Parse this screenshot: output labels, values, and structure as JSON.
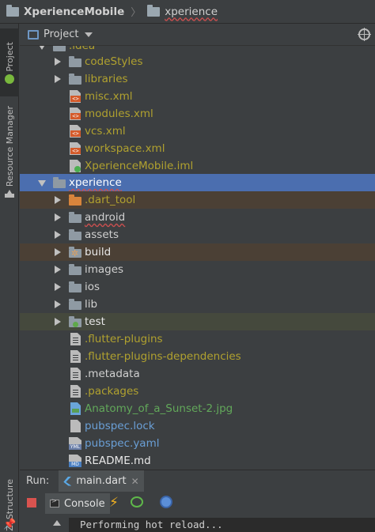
{
  "breadcrumb": {
    "root": "XperienceMobile",
    "child": "xperience"
  },
  "left_strip": {
    "project_tab": "1: Project",
    "resource_tab": "Resource Manager",
    "structure_tab": "Z: Structure"
  },
  "project_panel": {
    "title": "Project"
  },
  "tree": {
    "idea": ".idea",
    "codeStyles": "codeStyles",
    "libraries": "libraries",
    "misc": "misc.xml",
    "modules": "modules.xml",
    "vcs": "vcs.xml",
    "workspace": "workspace.xml",
    "iml": "XperienceMobile.iml",
    "xperience": "xperience",
    "dart_tool": ".dart_tool",
    "android": "android",
    "assets": "assets",
    "build": "build",
    "images": "images",
    "ios": "ios",
    "lib": "lib",
    "test": "test",
    "flutter_plugins": ".flutter-plugins",
    "flutter_plugins_deps": ".flutter-plugins-dependencies",
    "metadata": ".metadata",
    "packages": ".packages",
    "anatomy": "Anatomy_of_a_Sunset-2.jpg",
    "pubspec_lock": "pubspec.lock",
    "pubspec_yaml": "pubspec.yaml",
    "readme": "README.md"
  },
  "run_panel": {
    "label": "Run:",
    "tab": "main.dart",
    "console": "Console",
    "output": "Performing hot reload..."
  },
  "icons": {
    "project": "project-view-icon",
    "locate": "locate-target-icon",
    "hot_reload": "lightning-icon",
    "hot_restart": "refresh-icon",
    "devtools": "devtools-icon"
  }
}
